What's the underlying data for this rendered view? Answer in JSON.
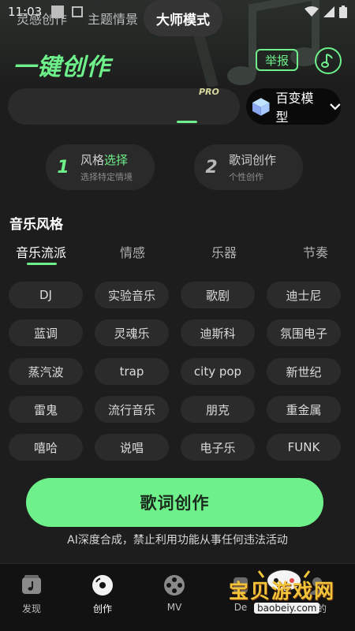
{
  "status_bar": {
    "time": "11:03"
  },
  "header": {
    "title": "一键创作",
    "report_label": "举报",
    "music_icon": "music-note-icon"
  },
  "modes": {
    "tabs": [
      "灵感创作",
      "主题情景",
      "大师模式"
    ],
    "active_index": 2,
    "pro_badge": "PRO",
    "model_button": "百变模型"
  },
  "steps": [
    {
      "number": "1",
      "title_a": "风格",
      "title_b": "选择",
      "subtitle": "选择特定情境"
    },
    {
      "number": "2",
      "title_a": "歌词创作",
      "title_b": "",
      "subtitle": "个性创作"
    }
  ],
  "music_style": {
    "section_title": "音乐风格",
    "categories": [
      "音乐流派",
      "情感",
      "乐器",
      "节奏"
    ],
    "active_category": 0,
    "chips": [
      "DJ",
      "实验音乐",
      "歌剧",
      "迪士尼",
      "蓝调",
      "灵魂乐",
      "迪斯科",
      "氛围电子",
      "蒸汽波",
      "trap",
      "city pop",
      "新世纪",
      "雷鬼",
      "流行音乐",
      "朋克",
      "重金属",
      "嘻哈",
      "说唱",
      "电子乐",
      "FUNK"
    ]
  },
  "cta": {
    "label": "歌词创作",
    "disclaimer": "AI深度合成，禁止利用功能从事任何违法活动"
  },
  "bottom_nav": [
    {
      "label": "发现",
      "icon": "discover-icon"
    },
    {
      "label": "创作",
      "icon": "disc-icon"
    },
    {
      "label": "MV",
      "icon": "film-reel-icon"
    },
    {
      "label": "De",
      "icon": "device-icon"
    },
    {
      "label": "我的",
      "icon": "profile-icon"
    }
  ],
  "watermark": {
    "text": "宝贝游戏网",
    "url": "baobeiy.com"
  },
  "colors": {
    "accent": "#6ef08a",
    "background": "#1d1d1d",
    "chip": "#2b2b2b"
  }
}
